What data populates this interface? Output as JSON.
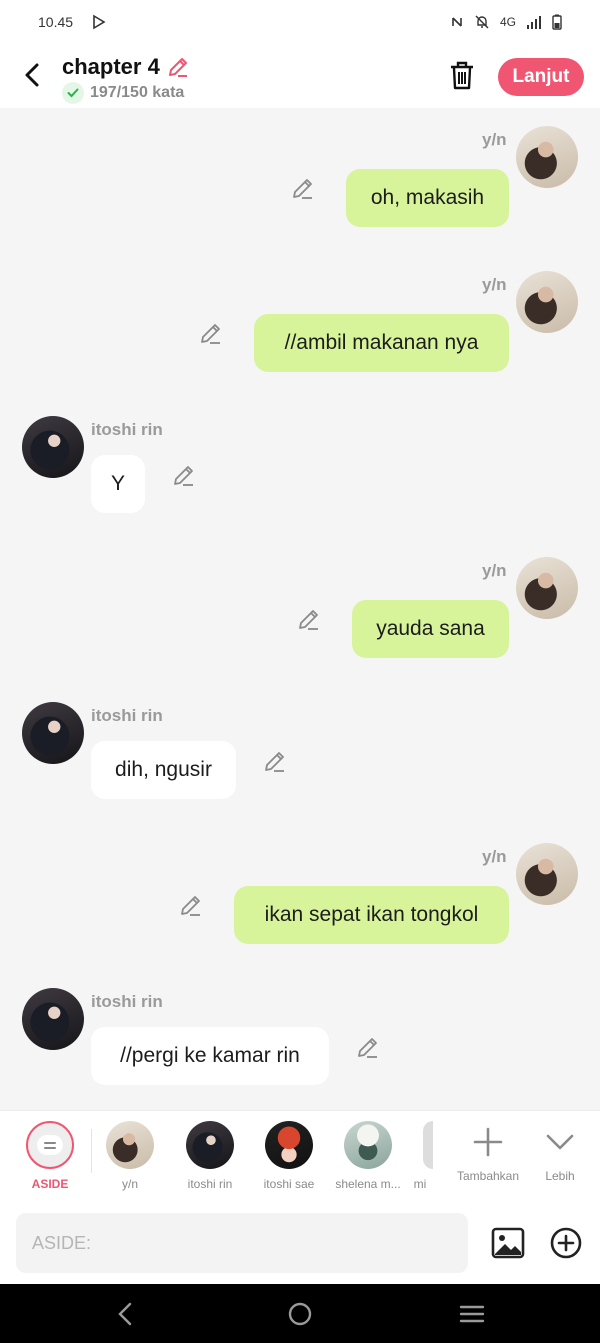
{
  "status": {
    "time": "10.45",
    "network": "4G"
  },
  "header": {
    "title": "chapter 4",
    "word_count": "197/150 kata",
    "next_label": "Lanjut"
  },
  "messages": [
    {
      "side": "right",
      "name": "y/n",
      "text": "oh, makasih"
    },
    {
      "side": "right",
      "name": "y/n",
      "text": "//ambil makanan nya"
    },
    {
      "side": "left",
      "name": "itoshi rin",
      "text": "Y"
    },
    {
      "side": "right",
      "name": "y/n",
      "text": "yauda sana"
    },
    {
      "side": "left",
      "name": "itoshi rin",
      "text": "dih, ngusir"
    },
    {
      "side": "right",
      "name": "y/n",
      "text": "ikan sepat ikan tongkol"
    },
    {
      "side": "left",
      "name": "itoshi rin",
      "text": "//pergi ke kamar rin"
    }
  ],
  "characters": [
    {
      "label": "ASIDE"
    },
    {
      "label": "y/n"
    },
    {
      "label": "itoshi rin"
    },
    {
      "label": "itoshi sae"
    },
    {
      "label": "shelena m..."
    },
    {
      "label": "mi"
    }
  ],
  "actions": {
    "add_label": "Tambahkan",
    "more_label": "Lebih"
  },
  "composer": {
    "placeholder": "ASIDE:"
  },
  "colors": {
    "accent": "#f05671",
    "bubble_green": "#d8f49b",
    "bubble_white": "#ffffff"
  }
}
